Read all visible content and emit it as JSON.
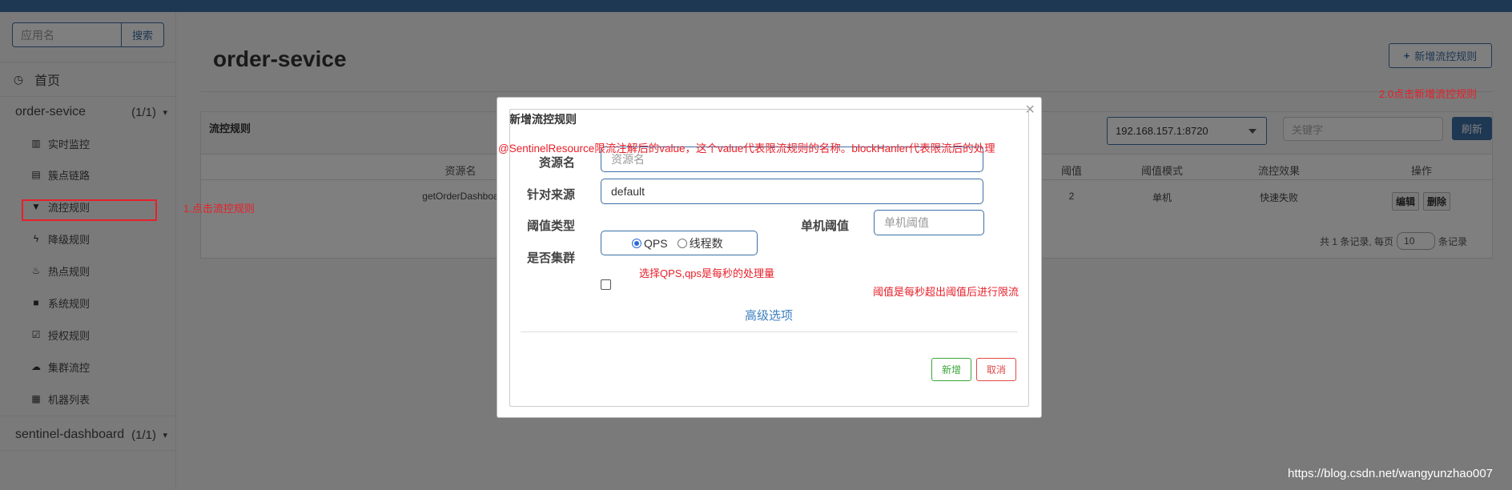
{
  "sidebar": {
    "search_placeholder": "应用名",
    "search_button": "搜索",
    "home": "首页",
    "apps": [
      {
        "name": "order-sevice",
        "count": "(1/1)",
        "items": [
          {
            "label": "实时监控",
            "icon": "bar-chart-icon"
          },
          {
            "label": "簇点链路",
            "icon": "list-icon"
          },
          {
            "label": "流控规则",
            "icon": "filter-icon"
          },
          {
            "label": "降级规则",
            "icon": "bolt-icon"
          },
          {
            "label": "热点规则",
            "icon": "fire-icon"
          },
          {
            "label": "系统规则",
            "icon": "lock-icon"
          },
          {
            "label": "授权规则",
            "icon": "check-circle-icon"
          },
          {
            "label": "集群流控",
            "icon": "cloud-icon"
          },
          {
            "label": "机器列表",
            "icon": "grid-icon"
          }
        ]
      },
      {
        "name": "sentinel-dashboard",
        "count": "(1/1)"
      }
    ]
  },
  "main": {
    "title": "order-sevice",
    "add_rule_button": "新增流控规则",
    "panel_title": "流控规则",
    "machine_select": "192.168.157.1:8720",
    "keyword_placeholder": "关键字",
    "refresh_button": "刷新",
    "columns": [
      "资源名",
      "阈值",
      "阈值模式",
      "流控效果",
      "操作"
    ],
    "rows": [
      {
        "resource": "getOrderDashboa",
        "threshold": "2",
        "mode": "单机",
        "effect": "快速失败",
        "edit": "编辑",
        "delete": "删除"
      }
    ],
    "pager": {
      "prefix": "共 1 条记录, 每页",
      "page_size": "10",
      "suffix": "条记录"
    }
  },
  "modal": {
    "title": "新增流控规则",
    "close": "×",
    "resource_label": "资源名",
    "resource_placeholder": "资源名",
    "origin_label": "针对来源",
    "origin_value": "default",
    "threshold_type_label": "阈值类型",
    "qps_option": "QPS",
    "thread_option": "线程数",
    "single_threshold_label": "单机阈值",
    "single_threshold_placeholder": "单机阈值",
    "cluster_label": "是否集群",
    "advanced_link": "高级选项",
    "save_button": "新增",
    "cancel_button": "取消"
  },
  "annotations": {
    "step1": "1.点击流控规则",
    "step2": "2.0点击新增流控规则",
    "sentinel_note": "@SentinelResource限流注解后的value，这个value代表限流规则的名称。blockHanler代表限流后的处理",
    "qps_note": "选择QPS,qps是每秒的处理量",
    "threshold_note": "阈值是每秒超出阈值后进行限流"
  },
  "watermark": "https://blog.csdn.net/wangyunzhao007",
  "colors": {
    "accent": "#3c6ea6",
    "annotation_red": "#e8202a",
    "save_green": "#3aa53a",
    "cancel_red": "#e04848"
  }
}
